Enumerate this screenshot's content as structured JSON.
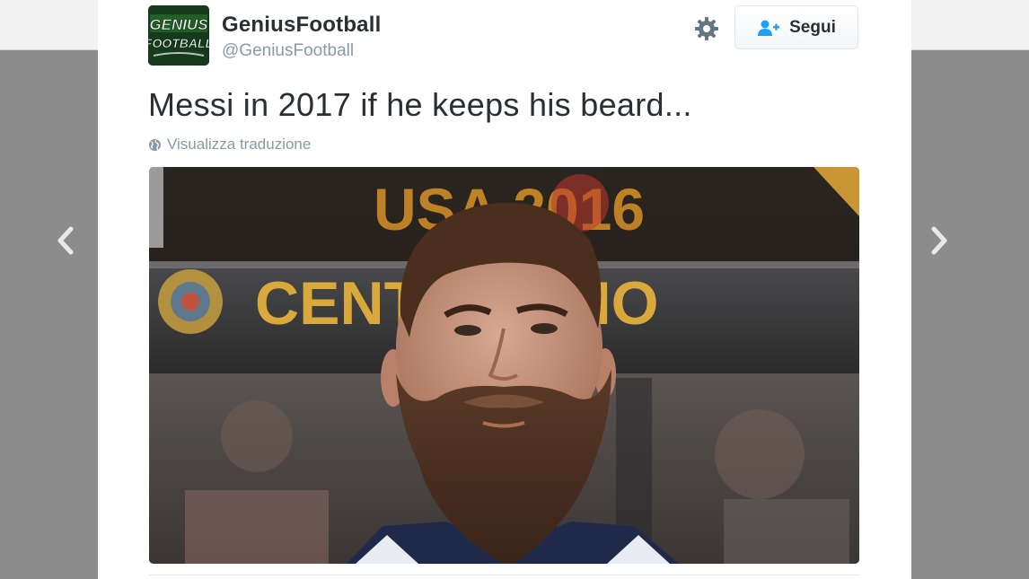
{
  "tweet": {
    "avatar_text_line1": "GENIUS",
    "avatar_text_line2": "FOOTBALL",
    "display_name": "GeniusFootball",
    "handle": "@GeniusFootball",
    "follow_label": "Segui",
    "text": "Messi in 2017 if he keeps his beard...",
    "translate_label": "Visualizza traduzione"
  },
  "media": {
    "banner_top": "USA 2016",
    "banner_mid": "CENTENARIO"
  },
  "icons": {
    "gear": "gear-icon",
    "follow": "add-user-icon",
    "globe": "globe-icon",
    "prev": "chevron-left-icon",
    "next": "chevron-right-icon"
  },
  "colors": {
    "text": "#292f33",
    "muted": "#8899a6",
    "follow_icon": "#1da1f2",
    "banner_gold": "#d9a93c",
    "banner_orange": "#f0a02a"
  }
}
